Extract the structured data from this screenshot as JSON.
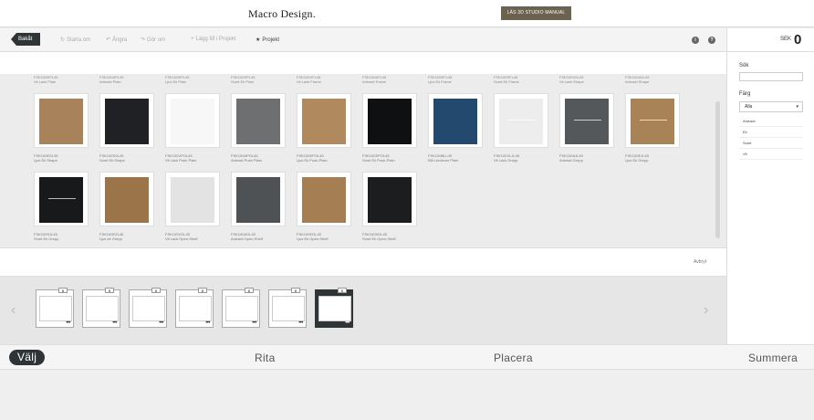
{
  "header": {
    "logo": "Macro Design.",
    "studio_button": "LÄS 3D STUDIO MANUAL"
  },
  "toolbar": {
    "back": "Bakåt",
    "start_over": "Starta om",
    "undo": "Ångra",
    "redo": "Gör om",
    "add_to_project": "Lägg till i Projekt",
    "project": "Projekt"
  },
  "right_panel": {
    "currency": "SEK",
    "total": "0",
    "search_label": "Sök",
    "color_label": "Färg",
    "color_selected": "Alla",
    "color_options": [
      "Antracit",
      "Ek",
      "Svart",
      "Vit"
    ]
  },
  "top_row_captions": [
    [
      "FSK100EPL45",
      "Vit Lack Plain"
    ],
    [
      "FSK100APL45",
      "Antracit Plain"
    ],
    [
      "FSK100EPL45",
      "Ljus Ek Plain"
    ],
    [
      "FSK100SPL45",
      "Svart Ek Plain"
    ],
    [
      "FSK100VFL45",
      "Vit Lack Frame"
    ],
    [
      "FSK100AFL45",
      "Antracit Frame"
    ],
    [
      "FSK100EFL45",
      "Ljus Ek Frame"
    ],
    [
      "FSK100SFL45",
      "Svart Ek Frame"
    ],
    [
      "FSK100VSL45",
      "Vit Lack Shape"
    ],
    [
      "FSK100ASL45",
      "Antracit Shape"
    ]
  ],
  "row1": [
    {
      "code": "FSK100ESL45",
      "name": "Ljus Ek Shape",
      "color": "#a7825a",
      "handle": false
    },
    {
      "code": "FSK100SSL45",
      "name": "Svart Ek Shape",
      "color": "#1f2124",
      "handle": false
    },
    {
      "code": "FSK100VPOL45",
      "name": "Vit Lack Push Plain",
      "color": "#f7f7f7",
      "handle": false
    },
    {
      "code": "FSK100APOL45",
      "name": "Antracit Push Plain",
      "color": "#6d6f71",
      "handle": false
    },
    {
      "code": "FSK100EPOL45",
      "name": "Ljus Ek Push-Plain",
      "color": "#b08a5e",
      "handle": false
    },
    {
      "code": "FSK100SPOL45",
      "name": "Svart Ek Push-Plain",
      "color": "#0f1012",
      "handle": false
    },
    {
      "code": "FSK100BLL45",
      "name": "Blå Linoleum Plain",
      "color": "#234a6e",
      "handle": false
    },
    {
      "code": "FSK100VLJL45",
      "name": "Vit Lack Grepp",
      "color": "#ededed",
      "handle": true
    },
    {
      "code": "FSK100AJL45",
      "name": "Antracit Grepp",
      "color": "#55585b",
      "handle": true
    },
    {
      "code": "FSK100EJL45",
      "name": "Ljus Ek Grepp",
      "color": "#a98358",
      "handle": true
    }
  ],
  "row2": [
    {
      "code": "FSK100SJL45",
      "name": "Svart Ek Grepp",
      "color": "#18191b",
      "handle": true
    },
    {
      "code": "FSK100EZL45",
      "name": "Ljus ek Grepp",
      "color": "#9c7449",
      "handle": false
    },
    {
      "code": "FSK100VOL45",
      "name": "Vit Lack Open-Shelf",
      "color": "#e3e3e3",
      "handle": false
    },
    {
      "code": "FSK100AOL45",
      "name": "Antracit Open-Shelf",
      "color": "#4f5254",
      "handle": false
    },
    {
      "code": "FSK100EOL45",
      "name": "Ljus Ek Open-Shelf",
      "color": "#a57e54",
      "handle": false
    },
    {
      "code": "FSK100SOL45",
      "name": "Svart Ek Open-Shelf",
      "color": "#1c1d1f",
      "handle": false
    }
  ],
  "cancel_label": "Avbryt",
  "product_strip": {
    "dots": "•••",
    "badge": "B"
  },
  "steps": [
    "Välj",
    "Rita",
    "Placera",
    "Summera"
  ]
}
